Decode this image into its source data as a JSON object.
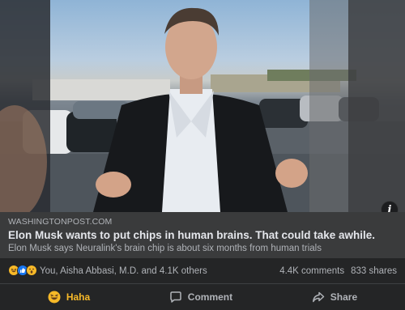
{
  "post": {
    "link": {
      "domain": "WASHINGTONPOST.COM",
      "headline": "Elon Musk wants to put chips in human brains. That could take awhile.",
      "description": "Elon Musk says Neuralink's brain chip is about six months from human trials"
    },
    "info_icon": "info-icon",
    "reactions": {
      "icons": [
        "haha-icon",
        "like-icon",
        "wow-icon"
      ],
      "summary": "You,  Aisha Abbasi, M.D. and 4.1K others"
    },
    "counts": {
      "comments": "4.4K comments",
      "shares": "833 shares"
    },
    "actions": {
      "reaction_label": "Haha",
      "comment_label": "Comment",
      "share_label": "Share"
    },
    "colors": {
      "haha": "#f7b928",
      "like": "#1877f2",
      "panel": "#3a3b3c",
      "background": "#242526"
    }
  }
}
